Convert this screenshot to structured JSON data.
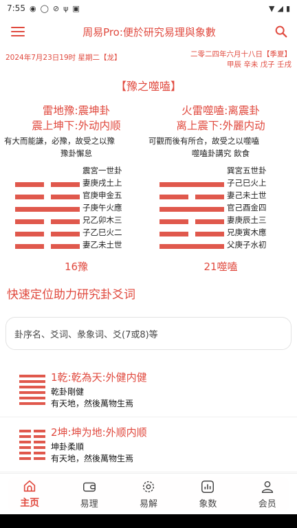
{
  "status": {
    "time": "7:55",
    "left_icons": [
      "chat-icon",
      "chat-bubble-icon",
      "blocked-icon",
      "usb-icon",
      "debug-icon"
    ],
    "right_icons": [
      "wifi-icon",
      "signal-icon",
      "battery-icon"
    ]
  },
  "appbar": {
    "title": "周易Pro:便於研究易理與象數",
    "menu_icon": "menu-icon",
    "search_icon": "search-icon"
  },
  "date": {
    "gregorian": "2024年7月23日19时 星期二【龙】",
    "lunar": "二零二四年六月十八日【季夏】",
    "ganzhi": "甲辰  辛未  戊子  壬戌"
  },
  "hexagram_title": "【豫之噬嗑】",
  "left_gua": {
    "name1": "雷地豫:震坤卦",
    "name2": "震上坤下:外动内顺",
    "desc": "有大而能謙，必豫，故受之以豫",
    "sub": "豫卦懈怠",
    "palace": "震宮一世卦",
    "lines": [
      "妻庚戌土上",
      "官庚申金五",
      "子庚午火應",
      "兄乙卯木三",
      "子乙巳火二",
      "妻乙未土世"
    ],
    "number": "16豫"
  },
  "right_gua": {
    "name1": "火雷噬嗑:离震卦",
    "name2": "离上震下:外麗内动",
    "desc": "可觀而後有所合，故受之以噬嗑",
    "sub": "噬嗑卦講究 飲食",
    "palace": "巽宮五世卦",
    "lines": [
      "子己巳火上",
      "妻己未土世",
      "官己酉金四",
      "妻庚辰土三",
      "兄庚寅木應",
      "父庚子水初"
    ],
    "number": "21噬嗑"
  },
  "section_title": "快速定位助力研究卦爻词",
  "search": {
    "placeholder": "卦序名、爻词、彖象词、爻(7或8)等"
  },
  "list": [
    {
      "title": "1乾:乾為天:外健内健",
      "line1": "乾卦剛健",
      "line2": "有天地，然後萬物生焉"
    },
    {
      "title": "2坤:坤为地:外顺内顺",
      "line1": "坤卦柔順",
      "line2": "有天地，然後萬物生焉"
    }
  ],
  "tabs": [
    {
      "label": "主页",
      "icon": "home-icon",
      "active": true
    },
    {
      "label": "易理",
      "icon": "wallet-icon"
    },
    {
      "label": "易解",
      "icon": "dial-icon"
    },
    {
      "label": "象数",
      "icon": "chart-icon"
    },
    {
      "label": "会员",
      "icon": "user-icon"
    }
  ],
  "colors": {
    "accent": "#e0493e",
    "yao": "#e0584c"
  }
}
